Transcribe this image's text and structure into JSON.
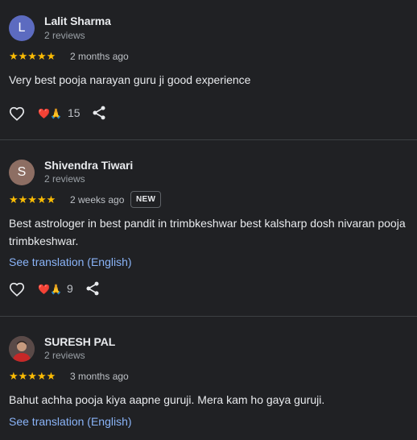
{
  "reviews": [
    {
      "avatar_letter": "L",
      "avatar_color": "#5c6bc0",
      "name": "Lalit Sharma",
      "review_count": "2 reviews",
      "stars": "★★★★★",
      "time": "2 months ago",
      "text": "Very best pooja narayan guru ji good experience",
      "reactions": "❤️🙏",
      "reaction_count": "15"
    },
    {
      "avatar_letter": "S",
      "avatar_color": "#8d6e63",
      "name": "Shivendra Tiwari",
      "review_count": "2 reviews",
      "stars": "★★★★★",
      "time": "2 weeks ago",
      "badge": "NEW",
      "text": "Best astrologer in best pandit in trimbkeshwar best kalsharp dosh nivaran pooja trimbkeshwar.",
      "translate_link": "See translation (English)",
      "reactions": "❤️🙏",
      "reaction_count": "9"
    },
    {
      "name": "SURESH PAL",
      "review_count": "2 reviews",
      "stars": "★★★★★",
      "time": "3 months ago",
      "text": "Bahut achha pooja kiya aapne guruji. Mera kam ho gaya guruji.",
      "translate_link": "See translation (English)"
    }
  ],
  "icons": {
    "like": "heart-outline-icon",
    "share": "share-icon"
  }
}
